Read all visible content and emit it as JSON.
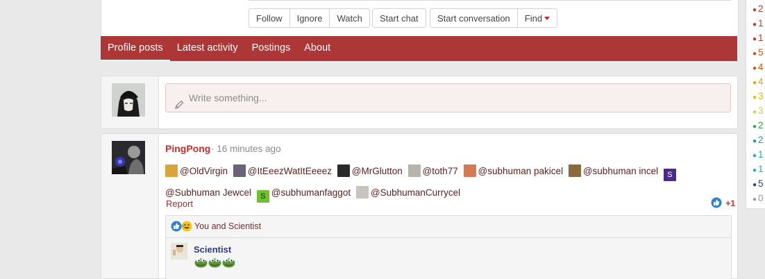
{
  "profile_actions": {
    "follow": "Follow",
    "ignore": "Ignore",
    "watch": "Watch",
    "start_chat": "Start chat",
    "start_conversation": "Start conversation",
    "find": "Find"
  },
  "tabs": [
    {
      "label": "Profile posts",
      "active": true
    },
    {
      "label": "Latest activity",
      "active": false
    },
    {
      "label": "Postings",
      "active": false
    },
    {
      "label": "About",
      "active": false
    }
  ],
  "composer": {
    "placeholder": "Write something...",
    "icon": "pencil-icon"
  },
  "post": {
    "author": "PingPong",
    "separator": "·",
    "time": "16 minutes ago",
    "mentions": [
      "@OldVirgin",
      "@ItEeezWatItEeeez",
      "@MrGlutton",
      "@toth77",
      "@subhuman pakicel",
      "@subhuman incel",
      "@Subhuman Jewcel",
      "@subhumanfaggot",
      "@SubhumanCurrycel"
    ],
    "mention_badges": {
      "s_purple": "S",
      "s_green": "S"
    },
    "report_label": "Report",
    "like_count": "+1",
    "likes_text": "You and Scientist",
    "comment": {
      "author": "Scientist"
    }
  },
  "sidebar_counts": [
    {
      "text": "2",
      "color": "#c0392b"
    },
    {
      "text": "1",
      "color": "#c0392b"
    },
    {
      "text": "1",
      "color": "#c0392b"
    },
    {
      "text": "5",
      "color": "#d35400"
    },
    {
      "text": "4",
      "color": "#d35400"
    },
    {
      "text": "4",
      "color": "#e0a800"
    },
    {
      "text": "3",
      "color": "#e0c000"
    },
    {
      "text": "3",
      "color": "#c8d44a"
    },
    {
      "text": "2",
      "color": "#27a844"
    },
    {
      "text": "2",
      "color": "#17a589"
    },
    {
      "text": "1",
      "color": "#1fa8c4"
    },
    {
      "text": "1",
      "color": "#1fa8c4"
    },
    {
      "text": "5",
      "color": "#2c3e8a"
    },
    {
      "text": "0",
      "color": "#999999"
    }
  ],
  "colors": {
    "accent": "#ad3737",
    "username": "#c62d2d"
  }
}
